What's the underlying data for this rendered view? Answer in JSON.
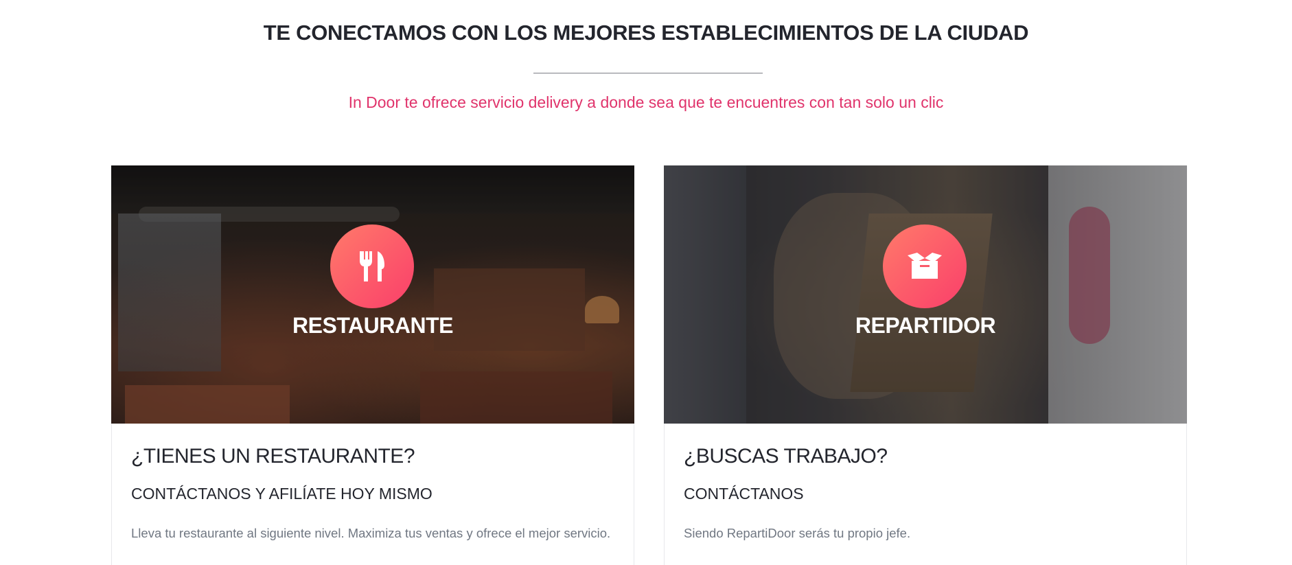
{
  "section": {
    "title": "TE CONECTAMOS CON LOS MEJORES ESTABLECIMIENTOS DE LA CIUDAD",
    "subtitle": "In Door te ofrece servicio delivery a donde sea que te encuentres con tan solo un clic"
  },
  "cards": [
    {
      "media_label": "RESTAURANTE",
      "icon": "fork-knife-icon",
      "heading": "¿TIENES UN RESTAURANTE?",
      "subheading": "CONTÁCTANOS Y AFILÍATE HOY MISMO",
      "text": "Lleva tu restaurante al siguiente nivel. Maximiza tus ventas y ofrece el mejor servicio."
    },
    {
      "media_label": "REPARTIDOR",
      "icon": "box-icon",
      "heading": "¿BUSCAS TRABAJO?",
      "subheading": "CONTÁCTANOS",
      "text": "Siendo RepartiDoor serás tu propio jefe."
    }
  ],
  "colors": {
    "accent": "#e0336b",
    "icon_gradient_start": "#ff7a6a",
    "icon_gradient_end": "#fa3f6a",
    "heading": "#23252d",
    "body_text": "#707782"
  }
}
